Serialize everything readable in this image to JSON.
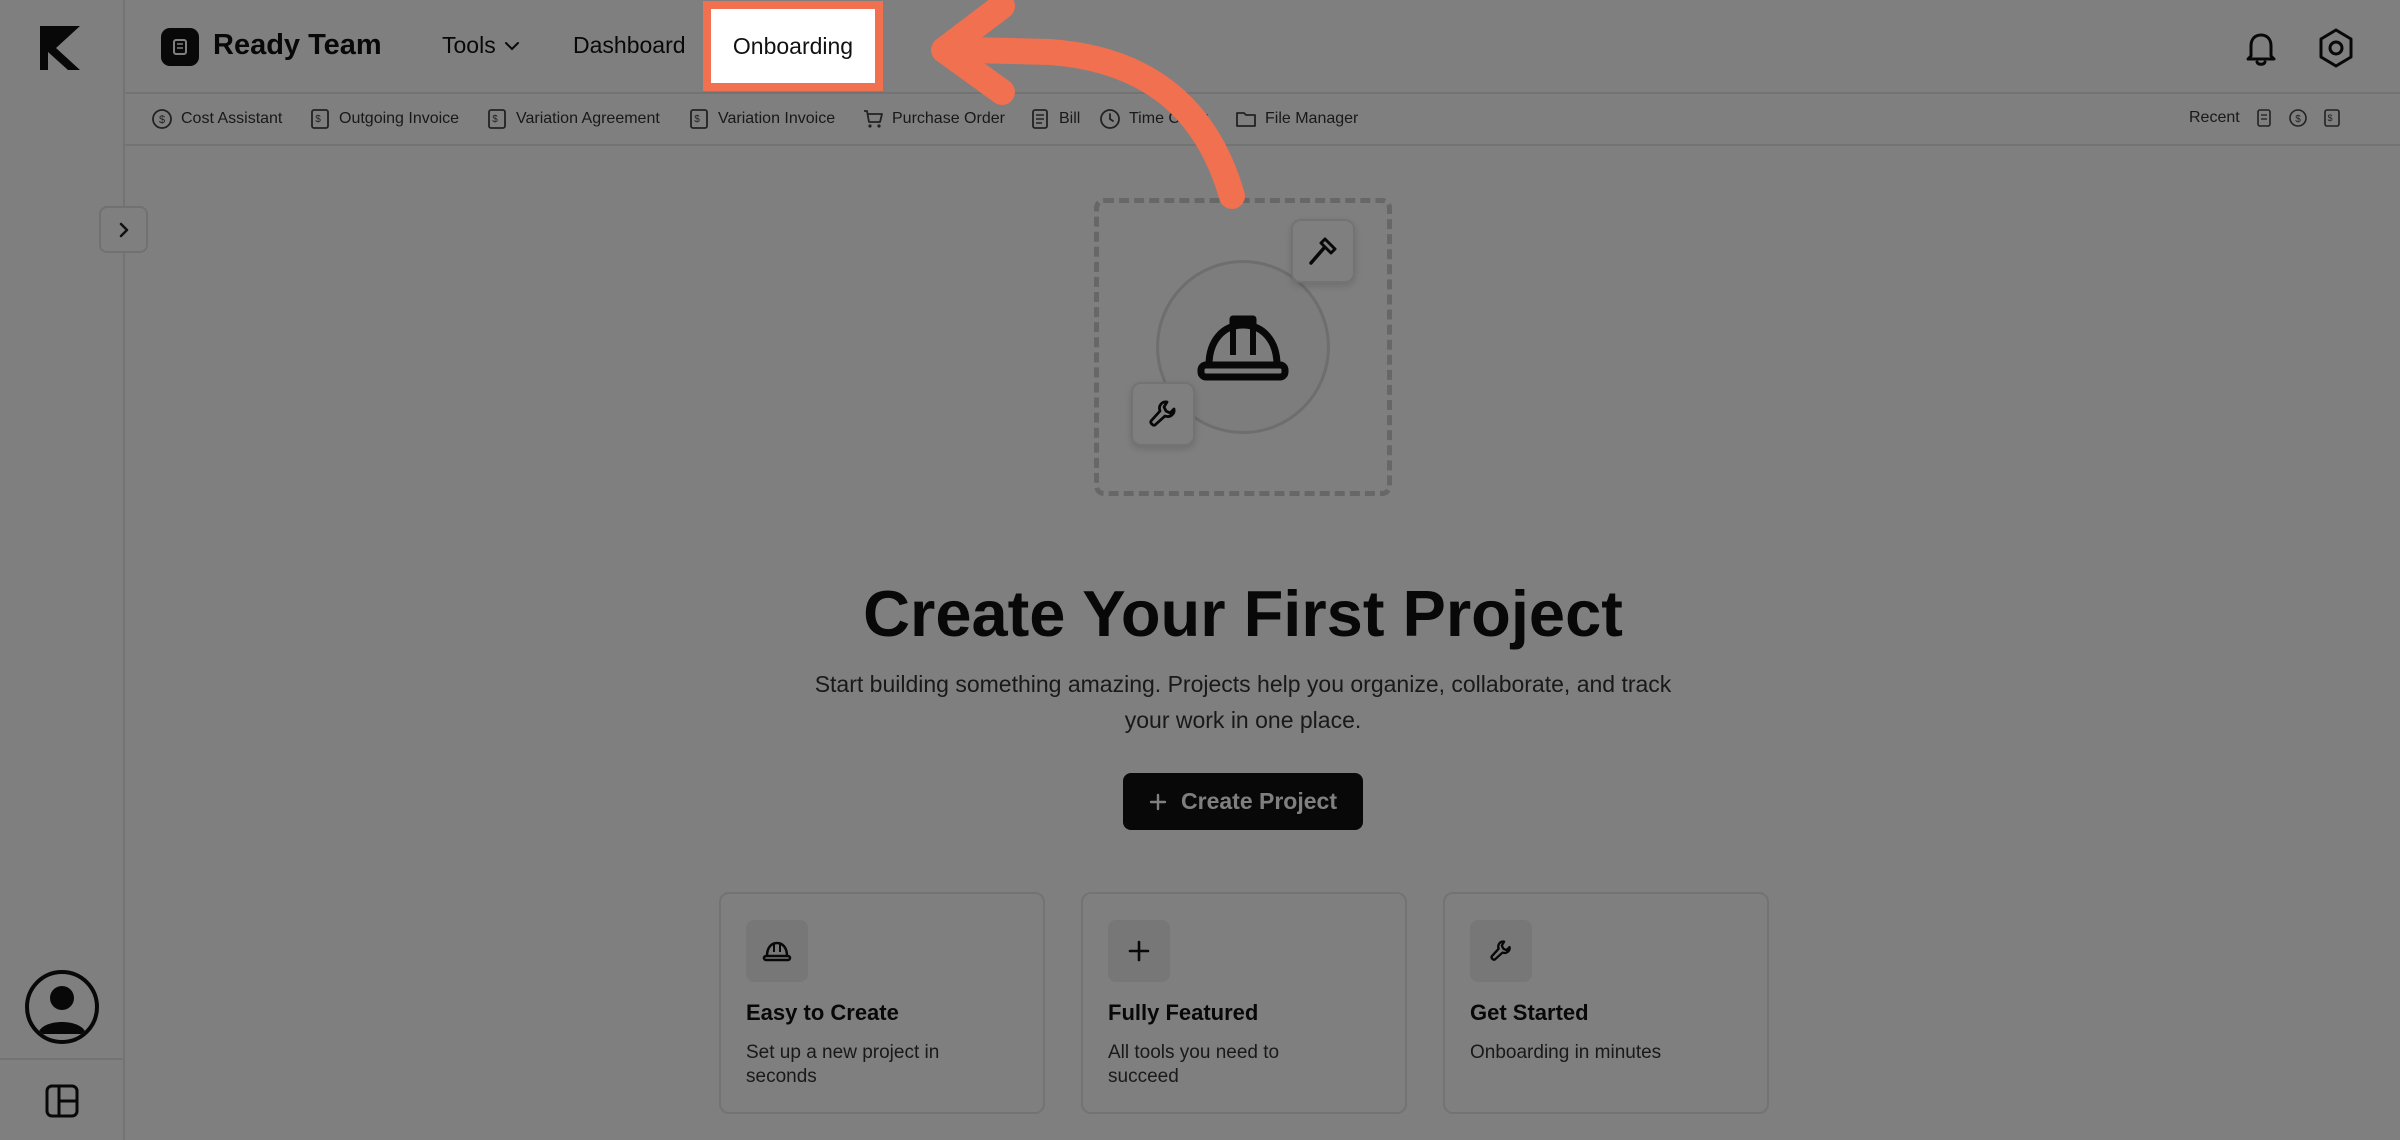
{
  "header": {
    "team_name": "Ready Team",
    "nav": {
      "tools_label": "Tools",
      "dashboard_label": "Dashboard",
      "onboarding_label": "Onboarding"
    }
  },
  "toolsbar": {
    "items": [
      {
        "label": "Cost Assistant",
        "icon": "dollar-circle-icon"
      },
      {
        "label": "Outgoing Invoice",
        "icon": "invoice-icon"
      },
      {
        "label": "Variation Agreement",
        "icon": "invoice-icon"
      },
      {
        "label": "Variation Invoice",
        "icon": "invoice-icon"
      },
      {
        "label": "Purchase Order",
        "icon": "cart-icon"
      },
      {
        "label": "Bill",
        "icon": "document-icon"
      },
      {
        "label": "Time Clock",
        "icon": "clock-icon"
      },
      {
        "label": "File Manager",
        "icon": "folder-icon"
      }
    ],
    "recent_label": "Recent"
  },
  "main": {
    "headline": "Create Your First Project",
    "subtext": "Start building something amazing. Projects help you organize, collaborate, and track your work in one place.",
    "create_button_label": "Create Project",
    "cards": [
      {
        "title": "Easy to Create",
        "description": "Set up a new project in seconds",
        "icon": "hard-hat-icon"
      },
      {
        "title": "Fully Featured",
        "description": "All tools you need to succeed",
        "icon": "plus-icon"
      },
      {
        "title": "Get Started",
        "description": "Onboarding in minutes",
        "icon": "wrench-icon"
      }
    ]
  },
  "colors": {
    "accent": "#f0704f",
    "primary_button": "#111111"
  }
}
